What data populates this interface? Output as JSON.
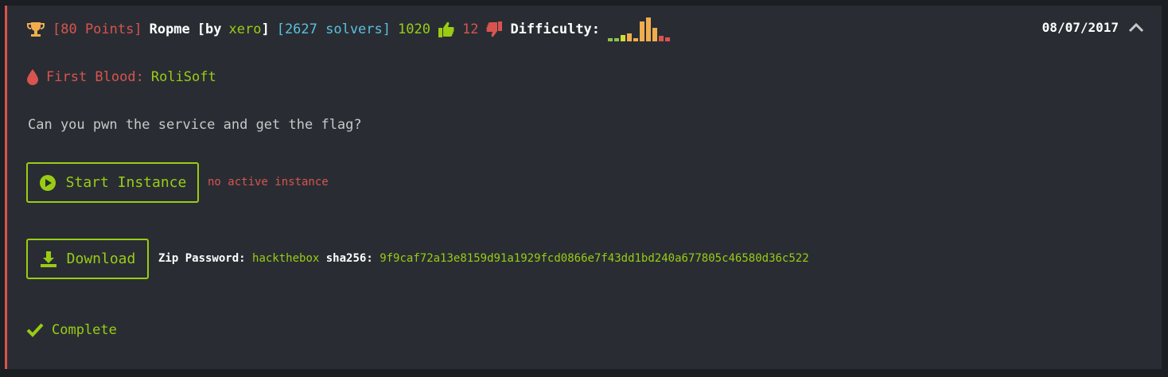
{
  "challenge": {
    "points": "[80 Points]",
    "name": "Ropme",
    "by_prefix": "[by",
    "author": "xero",
    "by_suffix": "]",
    "solvers": "[2627 solvers]",
    "likes": "1020",
    "dislikes": "12",
    "difficulty_label": "Difficulty:",
    "date": "08/07/2017",
    "first_blood_label": "First Blood:",
    "first_blood_user": "RoliSoft",
    "description": "Can you pwn the service and get the flag?",
    "start_button": "Start Instance",
    "instance_status": "no active instance",
    "download_button": "Download",
    "zip_password_label": "Zip Password:",
    "zip_password": "hackthebox",
    "sha_label": "sha256:",
    "sha256": "9f9caf72a13e8159d91a1929fcd0866e7f43dd1bd240a677805c46580d36c522",
    "status": "Complete"
  },
  "difficulty_chart": {
    "bar_levels": [
      0.12,
      0.12,
      0.25,
      0.33,
      0.12,
      0.83,
      1.0,
      0.55,
      0.22,
      0.17
    ],
    "bar_colors": [
      "#8bc34a",
      "#8bc34a",
      "#cddc39",
      "#f0ad4e",
      "#f0ad4e",
      "#f0ad4e",
      "#f0ad4e",
      "#f0ad4e",
      "#d9534f",
      "#d9534f"
    ]
  },
  "colors": {
    "accent_green": "#9acc14",
    "accent_red": "#d9534f",
    "accent_blue": "#5bc0de",
    "card_bg": "#292d33",
    "trophy": "#f0ad4e"
  },
  "icons": [
    "trophy-icon",
    "thumbs-up-icon",
    "thumbs-down-icon",
    "chevron-up-icon",
    "blood-drop-icon",
    "play-circle-icon",
    "download-icon",
    "check-icon"
  ]
}
